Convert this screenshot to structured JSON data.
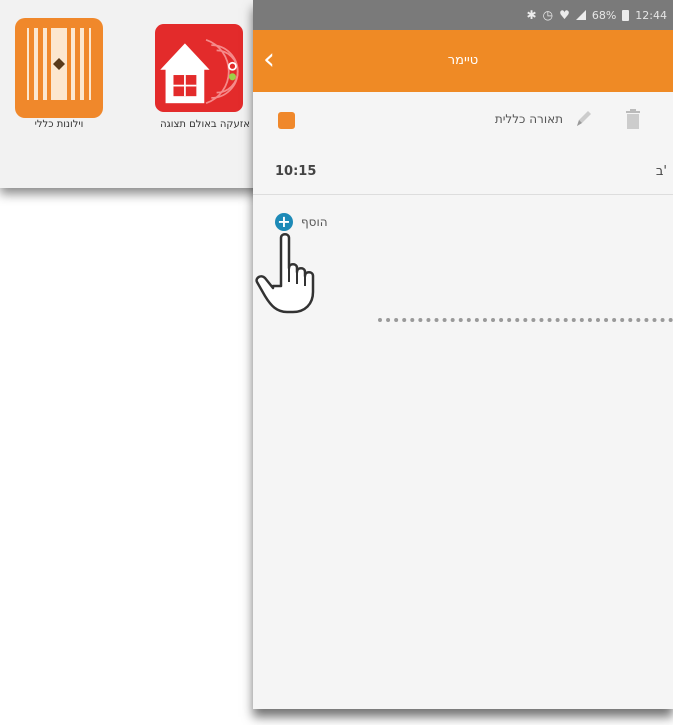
{
  "background_grid": {
    "tiles": [
      {
        "label": "וילונות כללי",
        "icon": "curtains-icon",
        "color": "#f0882b"
      },
      {
        "label": "אזעקה באולם תצוגה",
        "icon": "house-alarm-icon",
        "color": "#e32b2b"
      }
    ]
  },
  "status_bar": {
    "percent": "68%",
    "time": "12:44",
    "icons": [
      "bluetooth-icon",
      "alarm-clock-icon",
      "wifi-icon",
      "signal-icon",
      "battery-icon"
    ]
  },
  "app_bar": {
    "title": "טיימר",
    "back_icon": "chevron-left-icon",
    "color": "#ef8a25"
  },
  "timer_header": {
    "name": "תאורה כללית",
    "color": "#f0882b",
    "edit_icon": "pencil-icon",
    "delete_icon": "trash-icon"
  },
  "schedule": [
    {
      "time": "10:15",
      "day": "ב'"
    }
  ],
  "add_button": {
    "label": "הוסף",
    "icon": "plus-circle-icon",
    "color": "#1d8ab7"
  }
}
